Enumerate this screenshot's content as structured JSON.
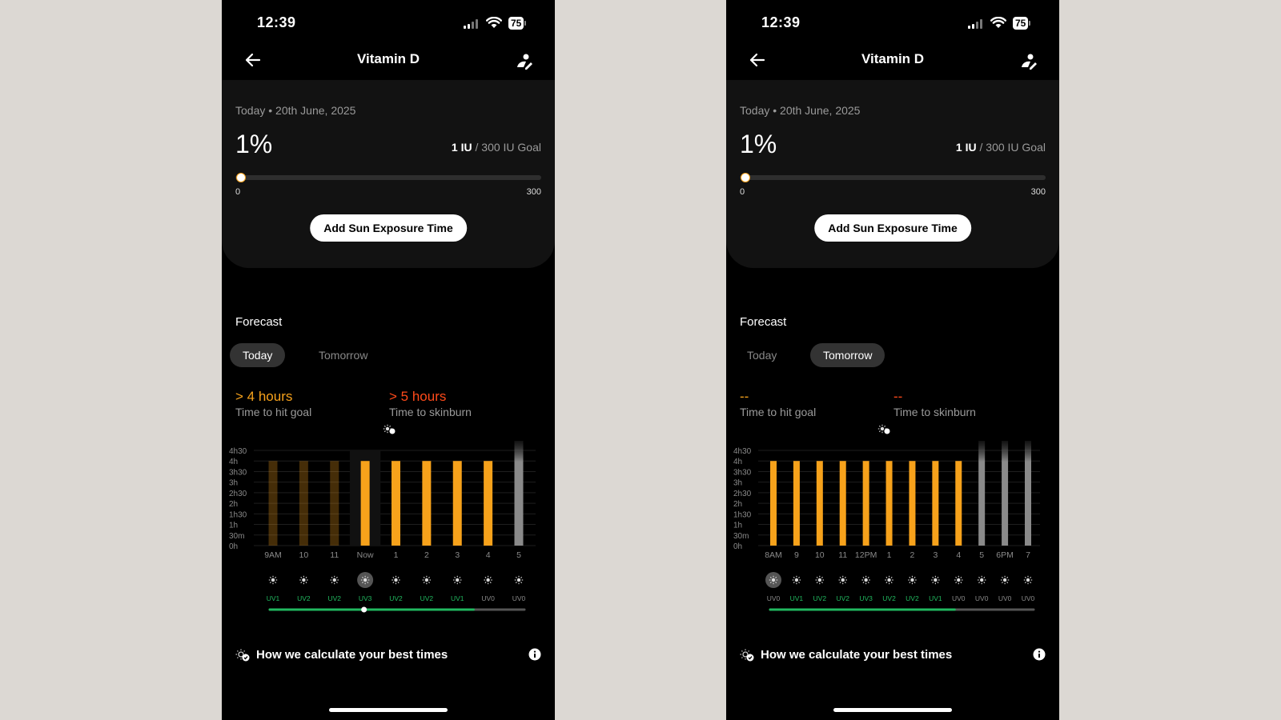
{
  "colors": {
    "accent": "#f7a21b",
    "burn": "#ff4a1a",
    "uv_green": "#21b85f"
  },
  "phones": [
    {
      "status": {
        "time": "12:39",
        "battery": "75"
      },
      "header": {
        "title": "Vitamin D"
      },
      "summary": {
        "date": "Today • 20th June, 2025",
        "percent": "1%",
        "current_iu": "1 IU",
        "goal_text": " / 300 IU Goal",
        "progress_fraction": 0.01,
        "range_min": "0",
        "range_max": "300",
        "add_button": "Add Sun Exposure Time"
      },
      "forecast": {
        "title": "Forecast",
        "tabs": [
          "Today",
          "Tomorrow"
        ],
        "active_tab": 0,
        "goal_value": "> 4 hours",
        "goal_label": "Time to hit goal",
        "burn_value": "> 5 hours",
        "burn_label": "Time to skinburn",
        "best_times_label": "How we calculate your best times"
      },
      "chart_data": {
        "type": "bar",
        "y_ticks": [
          "4h30",
          "4h",
          "3h30",
          "3h",
          "2h30",
          "2h",
          "1h30",
          "1h",
          "30m",
          "0h"
        ],
        "ylim": [
          0,
          4.5
        ],
        "categories": [
          "9AM",
          "10",
          "11",
          "Now",
          "1",
          "2",
          "3",
          "4",
          "5"
        ],
        "values": [
          4,
          4,
          4,
          4,
          4,
          4,
          4,
          4,
          5
        ],
        "bar_state": [
          "past",
          "past",
          "past",
          "future",
          "future",
          "future",
          "future",
          "future",
          "overflow"
        ],
        "uv": [
          "UV1",
          "UV2",
          "UV2",
          "UV3",
          "UV2",
          "UV2",
          "UV1",
          "UV0",
          "UV0"
        ],
        "current_index": 3,
        "selected_index": 3,
        "uv_green_fraction": 0.8,
        "timeline_marker_fraction": 0.37
      }
    },
    {
      "status": {
        "time": "12:39",
        "battery": "75"
      },
      "header": {
        "title": "Vitamin D"
      },
      "summary": {
        "date": "Today • 20th June, 2025",
        "percent": "1%",
        "current_iu": "1 IU",
        "goal_text": " / 300 IU Goal",
        "progress_fraction": 0.01,
        "range_min": "0",
        "range_max": "300",
        "add_button": "Add Sun Exposure Time"
      },
      "forecast": {
        "title": "Forecast",
        "tabs": [
          "Today",
          "Tomorrow"
        ],
        "active_tab": 1,
        "goal_value": "--",
        "goal_label": "Time to hit goal",
        "burn_value": "--",
        "burn_label": "Time to skinburn",
        "best_times_label": "How we calculate your best times"
      },
      "chart_data": {
        "type": "bar",
        "y_ticks": [
          "4h30",
          "4h",
          "3h30",
          "3h",
          "2h30",
          "2h",
          "1h30",
          "1h",
          "30m",
          "0h"
        ],
        "ylim": [
          0,
          4.5
        ],
        "categories": [
          "8AM",
          "9",
          "10",
          "11",
          "12PM",
          "1",
          "2",
          "3",
          "4",
          "5",
          "6PM",
          "7"
        ],
        "values": [
          4,
          4,
          4,
          4,
          4,
          4,
          4,
          4,
          4,
          5,
          5,
          5
        ],
        "bar_state": [
          "future",
          "future",
          "future",
          "future",
          "future",
          "future",
          "future",
          "future",
          "future",
          "overflow",
          "overflow",
          "overflow"
        ],
        "uv": [
          "UV0",
          "UV1",
          "UV2",
          "UV2",
          "UV3",
          "UV2",
          "UV2",
          "UV1",
          "UV0",
          "UV0",
          "UV0",
          "UV0"
        ],
        "current_index": -1,
        "selected_index": 0,
        "uv_green_fraction": 0.7,
        "timeline_marker_fraction": -1
      }
    }
  ]
}
